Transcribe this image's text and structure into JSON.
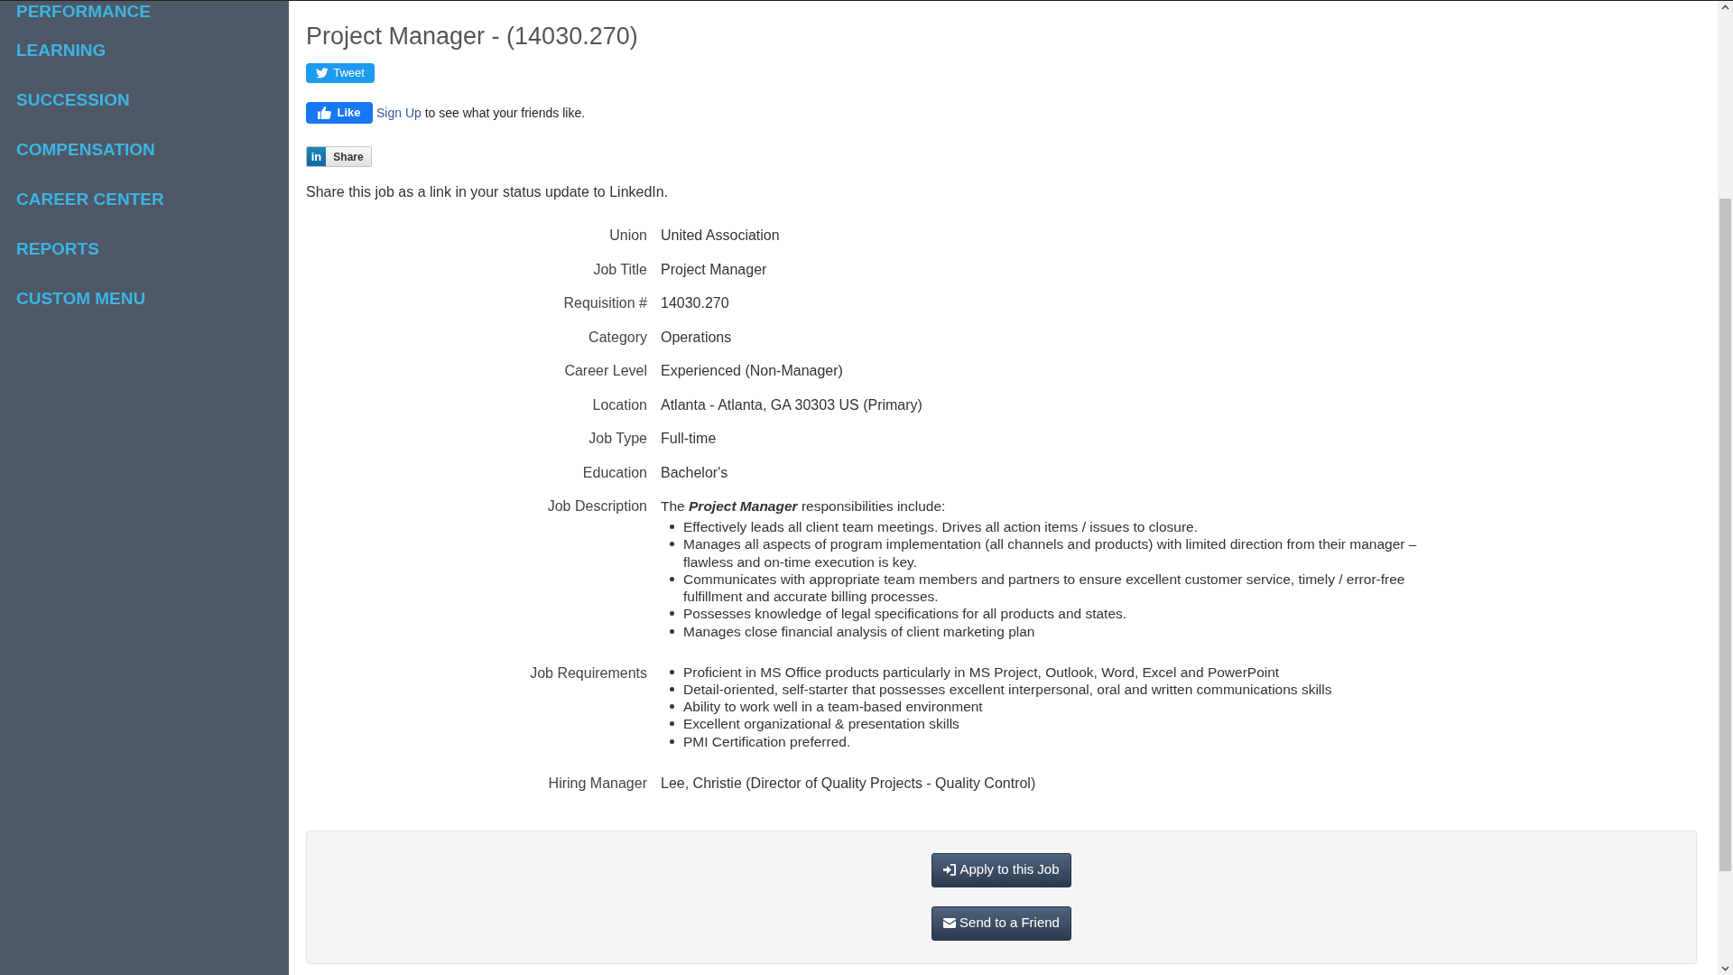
{
  "sidebar": {
    "items": [
      {
        "label": "PERFORMANCE"
      },
      {
        "label": "LEARNING"
      },
      {
        "label": "SUCCESSION"
      },
      {
        "label": "COMPENSATION"
      },
      {
        "label": "CAREER CENTER"
      },
      {
        "label": "REPORTS"
      },
      {
        "label": "CUSTOM MENU"
      }
    ]
  },
  "job": {
    "title": "Project Manager - (14030.270)",
    "social": {
      "tweet": "Tweet",
      "like": "Like",
      "like_note": {
        "link": "Sign Up",
        "text": "to see what your friends like."
      },
      "linkedin": {
        "logo": "in",
        "label": "Share"
      }
    },
    "share_note": "Share this job as a link in your status update to LinkedIn.",
    "details": [
      {
        "kind": "text",
        "label": "Union",
        "value": "United Association"
      },
      {
        "kind": "text",
        "label": "Job Title",
        "value": "Project Manager"
      },
      {
        "kind": "text",
        "label": "Requisition #",
        "value": "14030.270"
      },
      {
        "kind": "text",
        "label": "Category",
        "value": "Operations"
      },
      {
        "kind": "text",
        "label": "Career Level",
        "value": "Experienced (Non-Manager)"
      },
      {
        "kind": "text",
        "label": "Location",
        "value": "Atlanta - Atlanta, GA 30303 US (Primary)"
      },
      {
        "kind": "text",
        "label": "Job Type",
        "value": "Full-time"
      },
      {
        "kind": "text",
        "label": "Education",
        "value": "Bachelor's"
      },
      {
        "kind": "bullets",
        "label": "Job Description",
        "intro": "The **Project Manager** responsibilities include:",
        "bullets": [
          "Effectively leads all client team meetings. Drives all action items / issues to closure.",
          "Manages all aspects of program implementation (all channels and products) with limited direction from their manager – flawless and on-time execution is key.",
          "Communicates with appropriate team members and partners to ensure excellent customer service, timely / error-free fulfillment and accurate billing processes.",
          "Possesses knowledge of legal specifications for all products and states.",
          "Manages close financial analysis of client marketing plan"
        ]
      },
      {
        "kind": "bullets",
        "label": "Job Requirements",
        "bullets": [
          "Proficient in MS Office products particularly in MS Project, Outlook, Word, Excel and PowerPoint",
          "Detail-oriented, self-starter that possesses excellent interpersonal, oral and written communications skills",
          "Ability to work well in a team-based environment",
          "Excellent organizational & presentation skills",
          "PMI Certification preferred."
        ]
      },
      {
        "kind": "text",
        "label": "Hiring Manager",
        "value": "Lee, Christie (Director of Quality Projects - Quality Control)"
      }
    ],
    "actions": [
      {
        "kind": "apply",
        "label": "Apply to this Job"
      },
      {
        "kind": "send",
        "label": "Send to a Friend"
      }
    ]
  }
}
